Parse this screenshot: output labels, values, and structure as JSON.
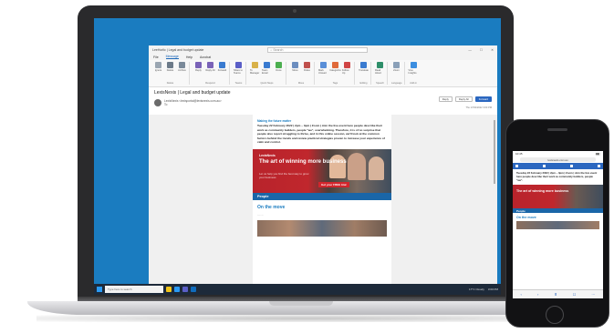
{
  "outlook": {
    "title": "LeeHorlic | Legal and budget update",
    "app": "Message (HTML)",
    "search_placeholder": "Search",
    "window_controls": [
      "—",
      "☐",
      "✕"
    ],
    "menu": [
      "File",
      "Message",
      "Help",
      "Acrobat"
    ],
    "active_menu": "Message",
    "ribbon_groups": [
      {
        "label": "Delete",
        "buttons": [
          "Ignore",
          "Delete",
          "Archive"
        ]
      },
      {
        "label": "Respond",
        "buttons": [
          "Reply",
          "Reply All",
          "Forward"
        ]
      },
      {
        "label": "Teams",
        "buttons": [
          "Share to Teams"
        ]
      },
      {
        "label": "Quick Steps",
        "buttons": [
          "To Manager",
          "Team Email",
          "Done"
        ]
      },
      {
        "label": "Move",
        "buttons": [
          "Move",
          "Rules"
        ]
      },
      {
        "label": "Tags",
        "buttons": [
          "Mark Unread",
          "Categorize",
          "Follow Up"
        ]
      },
      {
        "label": "Editing",
        "buttons": [
          "Translate"
        ]
      },
      {
        "label": "Speech",
        "buttons": [
          "Read Aloud"
        ]
      },
      {
        "label": "Language",
        "buttons": [
          "Zoom"
        ]
      },
      {
        "label": "Add-in",
        "buttons": [
          "Viva Insights"
        ]
      }
    ],
    "subject": "LexisNexis | Legal and budget update",
    "sender": "LexisNexis <lexisportal@lexisnexis.com.au>",
    "sender_to": "To",
    "actions": [
      "Reply",
      "Reply All",
      "Forward"
    ],
    "date": "Thu 17/02/2022 3:00 PM"
  },
  "email": {
    "heading": "Making the future matter",
    "body": "Tuesday 22 February 2022 | 2pm – 3pm | Zoom | Join the live event here people describe their work as community builders, people \"we\", overwhelming. Therefore, it is of no surprise that people also report struggling to thrive, and in this online session, we'll look at the common factors behind the trends and review practical strategies proven to increase your experience of calm and control.",
    "banner_brand": "LexisNexis",
    "banner_headline": "The art of winning more business",
    "banner_sub": "Let us help you find the best way to grow your business",
    "banner_cta": "Get your FREE trial",
    "section": "People",
    "on_move": "On the move",
    "dots": "......"
  },
  "taskbar": {
    "search_placeholder": "Type here to search",
    "weather": "17°C Cloudy",
    "time": "3:00 PM"
  },
  "phone": {
    "time": "10:45",
    "url": "lexisnexis.com.au",
    "body": "Tuesday 22 February 2022 | 2pm – 3pm | Zoom | Join the live event here people describe their work as community builders, people \"we\".",
    "banner_headline": "The art of winning more business",
    "section": "People",
    "on_move": "On the move",
    "nav": [
      "‹",
      "›",
      "⬆",
      "☐",
      "⋯"
    ]
  },
  "colors": {
    "desktop": "#1a7cc0",
    "accent": "#2b67c0",
    "brand_red": "#c0272d",
    "section_blue": "#1a66a8"
  }
}
